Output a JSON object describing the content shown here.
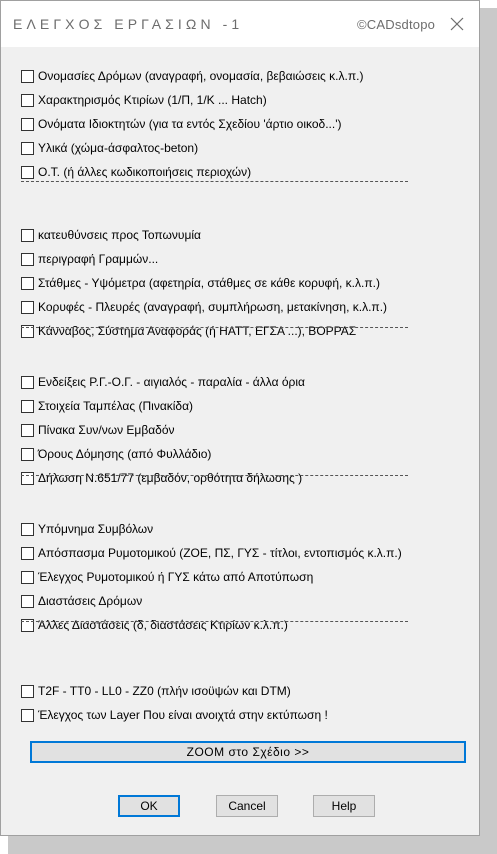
{
  "window": {
    "title": "ΕΛΕΓΧΟΣ ΕΡΓΑΣΙΩΝ -1",
    "copyright": "©CADsdtopo",
    "close_icon": "close-icon"
  },
  "groups": [
    [
      {
        "label": "Ονομασίες Δρόμων    (αναγραφή, ονομασία, βεβαιώσεις κ.λ.π.)",
        "checked": false
      },
      {
        "label": "Χαρακτηρισμός Κτιρίων (1/Π,   1/Κ  ... Hatch)",
        "checked": false
      },
      {
        "label": "Ονόματα Ιδιοκτητών  (για τα εντός Σχεδίου 'άρτιο  οικοδ...')",
        "checked": false
      },
      {
        "label": "Υλικά (χώμα-άσφαλτος-beton)",
        "checked": false
      },
      {
        "label": "Ο.Τ.  (ή άλλες κωδικοποιήσεις περιοχών)",
        "checked": false
      }
    ],
    [
      {
        "label": "κατευθύνσεις προς Τοπωνυμία",
        "checked": false
      },
      {
        "label": "περιγραφή Γραμμών...",
        "checked": false
      },
      {
        "label": "Στάθμες - Υψόμετρα     (αφετηρία, στάθμες σε κάθε κορυφή, κ.λ.π.)",
        "checked": false
      },
      {
        "label": "Κορυφές - Πλευρές     (αναγραφή, συμπλήρωση, μετακίνηση, κ.λ.π.)",
        "checked": false
      },
      {
        "label": "Κάνναβος, Σύστημα Αναφοράς (ή ΗΑΤΤ, ΕΓΣΑ ...),  ΒΟΡΡΑΣ",
        "checked": false
      }
    ],
    [
      {
        "label": "Ενδείξεις Ρ.Γ.-Ο.Γ.  - αιγιαλός  - παραλία  - άλλα όρια",
        "checked": false
      },
      {
        "label": "Στοιχεία Ταμπέλας  (Πινακίδα)",
        "checked": false
      },
      {
        "label": "Πίνακα Συν/νων  Εμβαδόν",
        "checked": false
      },
      {
        "label": "Όρους Δόμησης (από Φυλλάδιο)",
        "checked": false
      },
      {
        "label": "Δήλωση Ν.651/77 (εμβαδόν, ορθότητα δήλωσης )",
        "checked": false
      }
    ],
    [
      {
        "label": "Υπόμνημα Συμβόλων",
        "checked": false
      },
      {
        "label": "Απόσπασμα Ρυμοτομικού (ΖΟΕ, ΠΣ, ΓΥΣ  - τίτλοι, εντοπισμός κ.λ.π.)",
        "checked": false
      },
      {
        "label": "Έλεγχος Ρυμοτομικού ή ΓΥΣ κάτω από Αποτύπωση",
        "checked": false
      },
      {
        "label": "Διαστάσεις Δρόμων",
        "checked": false
      },
      {
        "label": "Άλλες Διαστάσεις  (δ, διαστάσεις Κτιρίων κ.λ.π.)",
        "checked": false
      }
    ],
    [
      {
        "label": "T2F  -  TT0  -  LL0  -  ZZ0 (πλήν ισοϋψών και DTM)",
        "checked": false
      },
      {
        "label": "Έλεγχος των Layer Που είναι ανοιχτά στην εκτύπωση !",
        "checked": false
      }
    ]
  ],
  "zoom_button": {
    "label": "ΖΟΟΜ  στο  Σχέδιο >>"
  },
  "buttons": {
    "ok": "OK",
    "cancel": "Cancel",
    "help": "Help"
  },
  "colors": {
    "accent": "#0078d7",
    "dialog_bg": "#f0f0f0",
    "titlebar_bg": "#ffffff"
  }
}
